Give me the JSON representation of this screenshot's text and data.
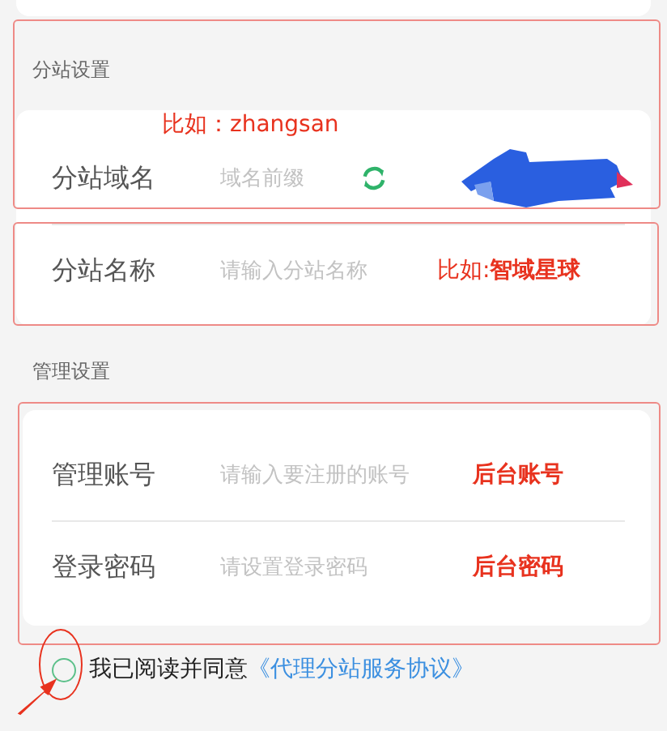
{
  "sections": [
    {
      "title": "分站设置",
      "rows": [
        {
          "kind": "domain",
          "label": "分站域名",
          "placeholder": "域名前缀",
          "note": "比如：zhangsan"
        },
        {
          "kind": "input",
          "label": "分站名称",
          "placeholder": "请输入分站名称",
          "note": "比如:**智域星球**"
        }
      ]
    },
    {
      "title": "管理设置",
      "rows": [
        {
          "kind": "input",
          "label": "管理账号",
          "placeholder": "请输入要注册的账号",
          "note": "**后台账号**"
        },
        {
          "kind": "input",
          "label": "登录密码",
          "placeholder": "请设置登录密码",
          "note": "**后台密码**"
        }
      ]
    }
  ],
  "agreement": {
    "checked": false,
    "text": "我已阅读并同意",
    "link": "《代理分站服务协议》"
  }
}
